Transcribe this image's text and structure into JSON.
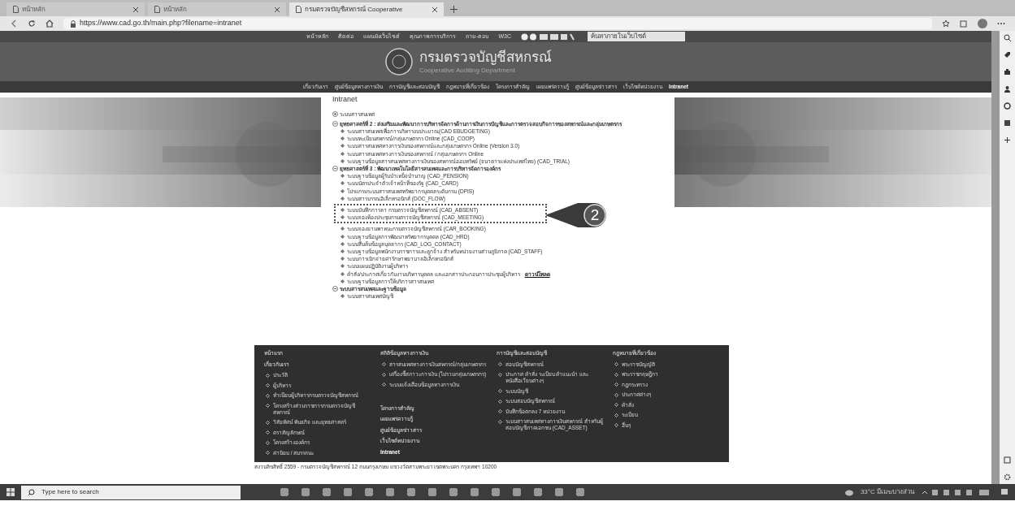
{
  "browser": {
    "tabs": [
      {
        "label": "หน้าหลัก",
        "selected": false
      },
      {
        "label": "หน้าหลัก",
        "selected": false
      },
      {
        "label": "กรมตรวจบัญชีสหกรณ์ Cooperative",
        "selected": true
      }
    ],
    "address": "https://www.cad.go.th/main.php?filename=intranet"
  },
  "site": {
    "top_links": [
      "หน้าหลัก",
      "ติดต่อ",
      "แผนผังเว็บไซต์",
      "คุณภาพการบริการ",
      "ถาม-ตอบ",
      "W3C"
    ],
    "search_placeholder": "ค้นหาภายในเว็บไซต์",
    "title": "กรมตรวจบัญชีสหกรณ์",
    "subtitle": "Cooperative Auditing Department",
    "nav": [
      {
        "label": "เกี่ยวกับเรา",
        "selected": false
      },
      {
        "label": "ศูนย์ข้อมูลทางการเงิน",
        "selected": false
      },
      {
        "label": "การบัญชีและสอบบัญชี",
        "selected": false
      },
      {
        "label": "กฎหมายที่เกี่ยวข้อง",
        "selected": false
      },
      {
        "label": "โครงการสำคัญ",
        "selected": false
      },
      {
        "label": "เผยแพร่ความรู้",
        "selected": false
      },
      {
        "label": "ศูนย์ข้อมูลข่าวสาร",
        "selected": false
      },
      {
        "label": "เว็บไซต์หน่วยงาน",
        "selected": false
      },
      {
        "label": "Intranet",
        "selected": true
      }
    ]
  },
  "content": {
    "heading": "Intranet",
    "sections": [
      {
        "title": "ระบบสารสนเทศ",
        "expanded": false
      },
      {
        "title": "ยุทธศาสตร์ที่ 2 : ส่งเสริมและพัฒนาการบริหารจัดการด้านการเงินการบัญชีและการตรวจสอบกิจการของสหกรณ์และกลุ่มเกษตรกร",
        "expanded": true,
        "items": [
          {
            "text": "ระบบสารสนเทศเพื่อการบริหารงบประมาณ(CAD EBUDGETING)"
          },
          {
            "text": "ระบบทะเบียนสหกรณ์/กลุ่มเกษตรกร Online (CAD_COOP)"
          },
          {
            "text": "ระบบสารสนเทศทางการเงินของสหกรณ์และกลุ่มเกษตรกร Online (Version 3.0)"
          },
          {
            "text": "ระบบสารสนเทศทางการเงินของสหกรณ์ / กลุ่มเกษตรกร Online"
          },
          {
            "text": "ระบบฐานข้อมูลสารสนเทศทางการเงินของสหกรณ์ออมทรัพย์ (ธนาคารแห่งประเทศไทย) (CAD_TRIAL)"
          }
        ]
      },
      {
        "title": "ยุทธศาสตร์ที่ 3 : พัฒนาเทคโนโลยีสารสนเทศและการบริหารจัดการองค์กร",
        "expanded": true,
        "items": [
          {
            "text": "ระบบฐานข้อมูลผู้รับบำเหน็จบำนาญ (CAD_PENSION)"
          },
          {
            "text": "ระบบบัตรประจำตัวเจ้าหน้าที่ของรัฐ (CAD_CARD)"
          },
          {
            "text": "โปรแกรมระบบสารสนเทศทรัพยากรบุคคลระดับกรม (DPIS)"
          },
          {
            "text": "ระบบสารบรรณอิเล็กทรอนิกส์ (DOC_FLOW)"
          },
          {
            "text": "ระบบบันทึกการลา กรมตรวจบัญชีสหกรณ์ (CAD_ABSENT)",
            "highlighted": true
          },
          {
            "text": "ระบบจองห้องประชุมกรมตรวจบัญชีสหกรณ์ (CAD_MEETING)",
            "highlighted": true
          },
          {
            "text": "ระบบจองยานพาหนะกรมตรวจบัญชีสหกรณ์ (CAR_BOOKING)"
          },
          {
            "text": "ระบบฐานข้อมูลการพัฒนาทรัพยากรบุคคล (CAD_HRD)"
          },
          {
            "text": "ระบบสืบค้นข้อมูลบุคลากร (CAD_LOG_CONTACT)"
          },
          {
            "text": "ระบบฐานข้อมูลพนักงานราชการและลูกจ้าง สำหรับหน่วยงานส่วนภูมิภาค (CAD_STAFF)"
          },
          {
            "text": "ระบบการเบิกจ่ายค่ารักษาพยาบาลอิเล็กทรอนิกส์"
          },
          {
            "text": "ระบบแผนปฏิบัติงานผู้บริหาร"
          },
          {
            "text": "คำสั่ง/ประกาศเกี่ยวกับงานบริหารบุคคล และเอกสารประกอบการประชุมผู้บริหาร",
            "link": "ดาวน์โหลด"
          },
          {
            "text": "ระบบฐานข้อมูลการให้บริการสารสนเทศ"
          }
        ]
      },
      {
        "title": "ระบบสารสนเทศและฐานข้อมูล",
        "expanded": true,
        "items": [
          {
            "text": "ระบบสารสนเทศบัญชี"
          }
        ]
      }
    ],
    "callout": "2"
  },
  "footer": {
    "columns": [
      {
        "entries": [
          {
            "kind": "heading",
            "text": "หน้าแรก"
          },
          {
            "kind": "heading",
            "text": "เกี่ยวกับเรา"
          },
          {
            "kind": "bullet",
            "text": "ประวัติ"
          },
          {
            "kind": "bullet",
            "text": "ผู้บริหาร"
          },
          {
            "kind": "bullet",
            "text": "ทำเนียบผู้บริหารกรมตรวจบัญชีสหกรณ์"
          },
          {
            "kind": "bullet",
            "text": "โครงสร้างส่วนราชการกรมตรวจบัญชีสหกรณ์"
          },
          {
            "kind": "bullet",
            "text": "วิสัยทัศน์ พันธกิจ และยุทธศาสตร์"
          },
          {
            "kind": "bullet",
            "text": "ตราสัญลักษณ์"
          },
          {
            "kind": "bullet",
            "text": "โครงสร้างองค์กร"
          },
          {
            "kind": "bullet",
            "text": "ค่านิยม / สมรรถนะ"
          }
        ]
      },
      {
        "entries": [
          {
            "kind": "heading",
            "text": "สถิติข้อมูลทางการเงิน"
          },
          {
            "kind": "bullet",
            "text": "สารสนเทศทางการเงินสหกรณ์/กลุ่มเกษตรกร"
          },
          {
            "kind": "bullet",
            "text": "เครื่องชี้สภาวะการเงิน (ไม่รวมกลุ่มเกษตรกร)"
          },
          {
            "kind": "bullet",
            "text": "ระบบแจ้งเตือนข้อมูลทางการเงิน"
          },
          {
            "kind": "spacer"
          },
          {
            "kind": "heading",
            "text": "โครงการสำคัญ"
          },
          {
            "kind": "heading",
            "text": "เผยแพร่ความรู้"
          },
          {
            "kind": "heading",
            "text": "ศูนย์ข้อมูลข่าวสาร"
          },
          {
            "kind": "heading",
            "text": "เว็บไซต์หน่วยงาน"
          },
          {
            "kind": "strong",
            "text": "Intranet"
          }
        ]
      },
      {
        "entries": [
          {
            "kind": "heading",
            "text": "การบัญชีและสอบบัญชี"
          },
          {
            "kind": "bullet",
            "text": "สอบบัญชีสหกรณ์"
          },
          {
            "kind": "bullet",
            "text": "ประกาศ คำสั่ง ระเบียบ คำแนะนำ และหนังสือเวียนต่างๆ"
          },
          {
            "kind": "bullet",
            "text": "ระบบบัญชี"
          },
          {
            "kind": "bullet",
            "text": "ระบบสอบบัญชีสหกรณ์"
          },
          {
            "kind": "bullet",
            "text": "บันทึกข้อตกลง 7 หน่วยงาน"
          },
          {
            "kind": "bullet",
            "text": "ระบบสารสนเทศทางการเงินสหกรณ์ สำหรับผู้สอบบัญชีภาคเอกชน (CAD_ASSET)"
          }
        ]
      },
      {
        "entries": [
          {
            "kind": "heading",
            "text": "กฎหมายที่เกี่ยวข้อง"
          },
          {
            "kind": "bullet",
            "text": "พระราชบัญญัติ"
          },
          {
            "kind": "bullet",
            "text": "พระราชกฤษฎีกา"
          },
          {
            "kind": "bullet",
            "text": "กฎกระทรวง"
          },
          {
            "kind": "bullet",
            "text": "ประกาศต่างๆ"
          },
          {
            "kind": "bullet",
            "text": "คำสั่ง"
          },
          {
            "kind": "bullet",
            "text": "ระเบียบ"
          },
          {
            "kind": "bullet",
            "text": "อื่นๆ"
          }
        ]
      }
    ],
    "copyright": "สงวนลิขสิทธิ์ 2559 - กรมตรวจบัญชีสหกรณ์ 12 ถนนกรุงเกษม แขวงวัดสามพระยา เขตพระนคร กรุงเทพฯ 10200"
  },
  "taskbar": {
    "search_placeholder": "Type here to search",
    "weather": "33°C มีเมฆบางส่วน"
  }
}
